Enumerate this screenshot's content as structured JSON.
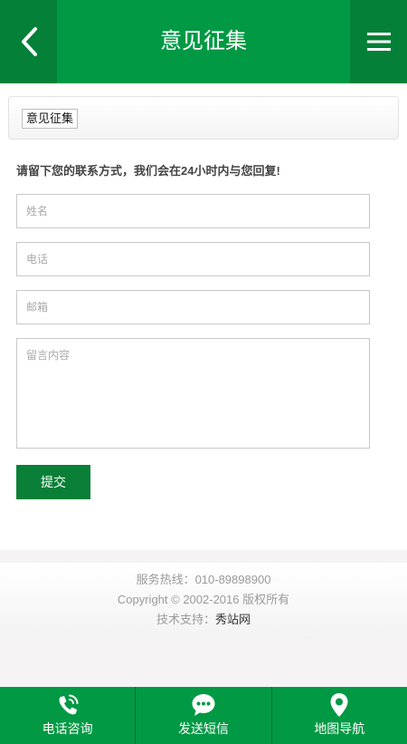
{
  "header": {
    "title": "意见征集",
    "back_icon": "chevron-left-icon",
    "menu_icon": "hamburger-menu-icon"
  },
  "breadcrumb": {
    "label": "意见征集"
  },
  "form": {
    "notice": "请留下您的联系方式，我们会在24小时内与您回复!",
    "name_placeholder": "姓名",
    "phone_placeholder": "电话",
    "email_placeholder": "邮箱",
    "message_placeholder": "留言内容",
    "submit_label": "提交"
  },
  "footer": {
    "hotline": "服务热线：010-89898900",
    "copyright": "Copyright © 2002-2016 版权所有",
    "support_prefix": "技术支持：",
    "support_link": "秀站网"
  },
  "bottom_nav": [
    {
      "label": "电话咨询",
      "icon": "phone-icon"
    },
    {
      "label": "发送短信",
      "icon": "chat-bubble-icon"
    },
    {
      "label": "地图导航",
      "icon": "map-pin-icon"
    }
  ],
  "colors": {
    "brand_green": "#019944",
    "dark_green": "#048038",
    "button_green": "#0a7f38"
  }
}
